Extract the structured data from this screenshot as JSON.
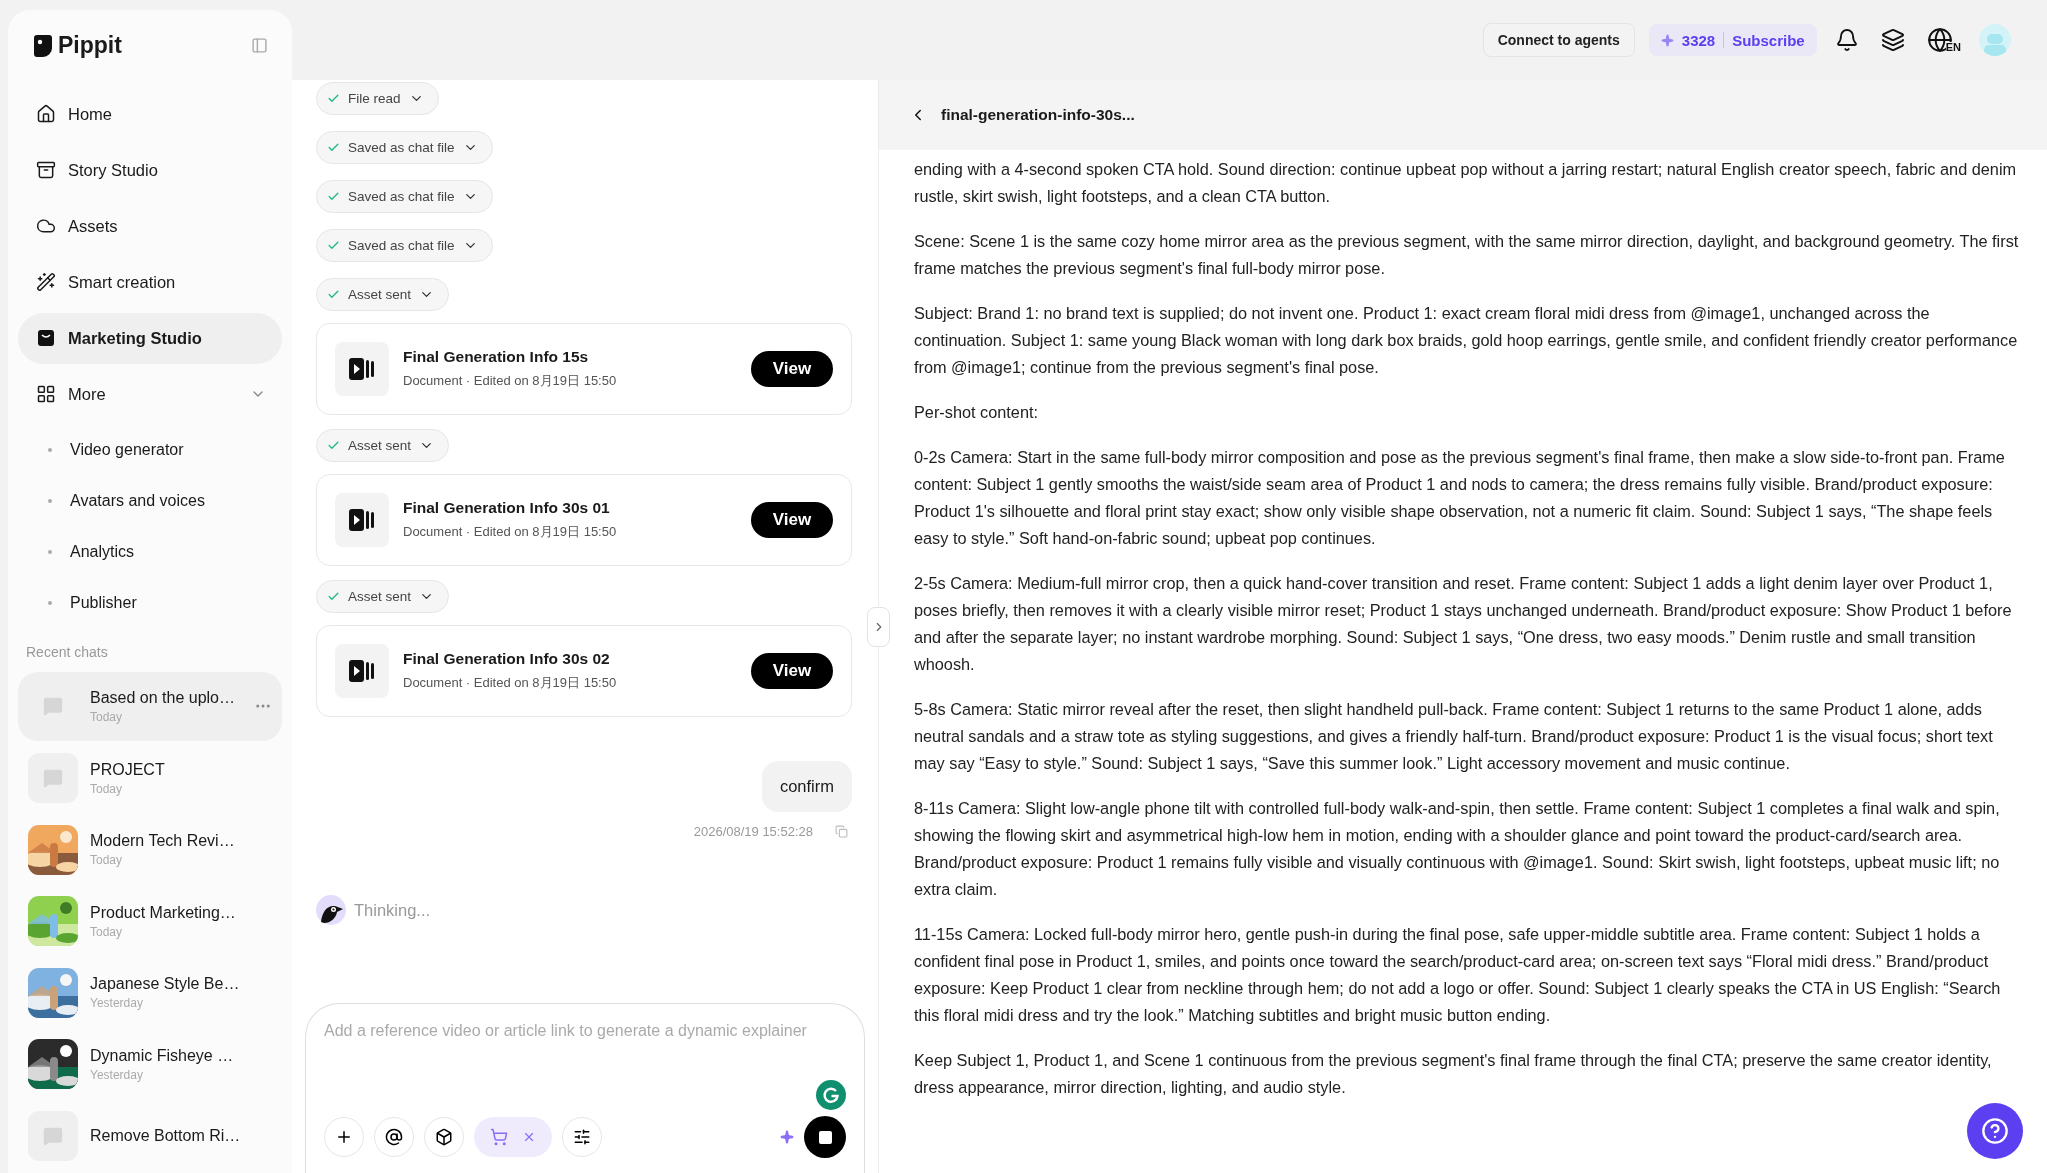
{
  "sidebar": {
    "logo": "Pippit",
    "nav": [
      {
        "label": "Home",
        "kind": "link",
        "selected": false
      },
      {
        "label": "Story Studio",
        "kind": "link",
        "selected": false
      },
      {
        "label": "Assets",
        "kind": "link",
        "selected": false
      },
      {
        "label": "Smart creation",
        "kind": "link",
        "selected": false
      },
      {
        "label": "Marketing Studio",
        "kind": "link",
        "selected": true
      },
      {
        "label": "More",
        "kind": "group",
        "selected": false,
        "expanded": true
      },
      {
        "label": "Video generator",
        "kind": "sub",
        "selected": false
      },
      {
        "label": "Avatars and voices",
        "kind": "sub",
        "selected": false
      },
      {
        "label": "Analytics",
        "kind": "sub",
        "selected": false
      },
      {
        "label": "Publisher",
        "kind": "sub",
        "selected": false
      }
    ],
    "recent_heading": "Recent chats",
    "recent_chats": [
      {
        "title": "Based on the uplo…",
        "time": "Today",
        "kind": "placeholder",
        "selected": true
      },
      {
        "title": "PROJECT",
        "time": "Today",
        "kind": "placeholder",
        "selected": false
      },
      {
        "title": "Modern Tech Revi…",
        "time": "Today",
        "kind": "picture",
        "selected": false
      },
      {
        "title": "Product Marketing…",
        "time": "Today",
        "kind": "picture",
        "selected": false
      },
      {
        "title": "Japanese Style Be…",
        "time": "Yesterday",
        "kind": "picture",
        "selected": false
      },
      {
        "title": "Dynamic Fisheye …",
        "time": "Yesterday",
        "kind": "picture",
        "selected": false
      },
      {
        "title": "Remove Bottom Ri…",
        "kind": "placeholder",
        "selected": false
      }
    ]
  },
  "topbar": {
    "connect": "Connect to agents",
    "credits": "3328",
    "subscribe": "Subscribe",
    "language": "EN"
  },
  "chat": {
    "messages": [
      {
        "kind": "status",
        "label": "File read",
        "done": true
      },
      {
        "kind": "status",
        "label": "Saved as chat file",
        "done": true
      },
      {
        "kind": "status",
        "label": "Saved as chat file",
        "done": true
      },
      {
        "kind": "status",
        "label": "Saved as chat file",
        "done": true
      },
      {
        "kind": "status",
        "label": "Asset sent",
        "done": true
      },
      {
        "kind": "asset",
        "title": "Final Generation Info 15s",
        "meta": "Document · Edited on 8月19日 15:50",
        "action": "View"
      },
      {
        "kind": "status",
        "label": "Asset sent",
        "done": true
      },
      {
        "kind": "asset",
        "title": "Final Generation Info 30s 01",
        "meta": "Document · Edited on 8月19日 15:50",
        "action": "View"
      },
      {
        "kind": "status",
        "label": "Asset sent",
        "done": true
      },
      {
        "kind": "asset",
        "title": "Final Generation Info 30s 02",
        "meta": "Document · Edited on 8月19日 15:50",
        "action": "View"
      },
      {
        "kind": "user",
        "text": "confirm",
        "timestamp": "2026/08/19 15:52:28"
      },
      {
        "kind": "thinking",
        "text": "Thinking..."
      }
    ],
    "composer": {
      "placeholder": "Add a reference video or article link to generate a dynamic explainer"
    }
  },
  "document": {
    "title": "final-generation-info-30s...",
    "paragraphs": [
      "ending with a 4-second spoken CTA hold. Sound direction: continue upbeat pop without a jarring restart; natural English creator speech, fabric and denim rustle, skirt swish, light footsteps, and a clean CTA button.",
      "Scene: Scene 1 is the same cozy home mirror area as the previous segment, with the same mirror direction, daylight, and background geometry. The first frame matches the previous segment's final full-body mirror pose.",
      "Subject: Brand 1: no brand text is supplied; do not invent one. Product 1: exact cream floral midi dress from @image1, unchanged across the continuation. Subject 1: same young Black woman with long dark box braids, gold hoop earrings, gentle smile, and confident friendly creator performance from @image1; continue from the previous segment's final pose.",
      "Per-shot content:",
      "0-2s Camera: Start in the same full-body mirror composition and pose as the previous segment's final frame, then make a slow side-to-front pan. Frame content: Subject 1 gently smooths the waist/side seam area of Product 1 and nods to camera; the dress remains fully visible. Brand/product exposure: Product 1's silhouette and floral print stay exact; show only visible shape observation, not a numeric fit claim. Sound: Subject 1 says, “The shape feels easy to style.” Soft hand-on-fabric sound; upbeat pop continues.",
      "2-5s Camera: Medium-full mirror crop, then a quick hand-cover transition and reset. Frame content: Subject 1 adds a light denim layer over Product 1, poses briefly, then removes it with a clearly visible mirror reset; Product 1 stays unchanged underneath. Brand/product exposure: Show Product 1 before and after the separate layer; no instant wardrobe morphing. Sound: Subject 1 says, “One dress, two easy moods.” Denim rustle and small transition whoosh.",
      "5-8s Camera: Static mirror reveal after the reset, then slight handheld pull-back. Frame content: Subject 1 returns to the same Product 1 alone, adds neutral sandals and a straw tote as styling suggestions, and gives a friendly half-turn. Brand/product exposure: Product 1 is the visual focus; short text may say “Easy to style.” Sound: Subject 1 says, “Save this summer look.” Light accessory movement and music continue.",
      "8-11s Camera: Slight low-angle phone tilt with controlled full-body walk-and-spin, then settle. Frame content: Subject 1 completes a final walk and spin, showing the flowing skirt and asymmetrical high-low hem in motion, ending with a shoulder glance and point toward the product-card/search area. Brand/product exposure: Product 1 remains fully visible and visually continuous with @image1. Sound: Skirt swish, light footsteps, upbeat music lift; no extra claim.",
      "11-15s Camera: Locked full-body mirror hero, gentle push-in during the final pose, safe upper-middle subtitle area. Frame content: Subject 1 holds a confident final pose in Product 1, smiles, and points once toward the search/product-card area; on-screen text says “Floral midi dress.” Brand/product exposure: Keep Product 1 clear from neckline through hem; do not add a logo or offer. Sound: Subject 1 clearly speaks the CTA in US English: “Search this floral midi dress and try the look.” Matching subtitles and bright music button ending.",
      "Keep Subject 1, Product 1, and Scene 1 continuous from the previous segment's final frame through the final CTA; preserve the same creator identity, dress appearance, mirror direction, lighting, and audio style."
    ]
  }
}
